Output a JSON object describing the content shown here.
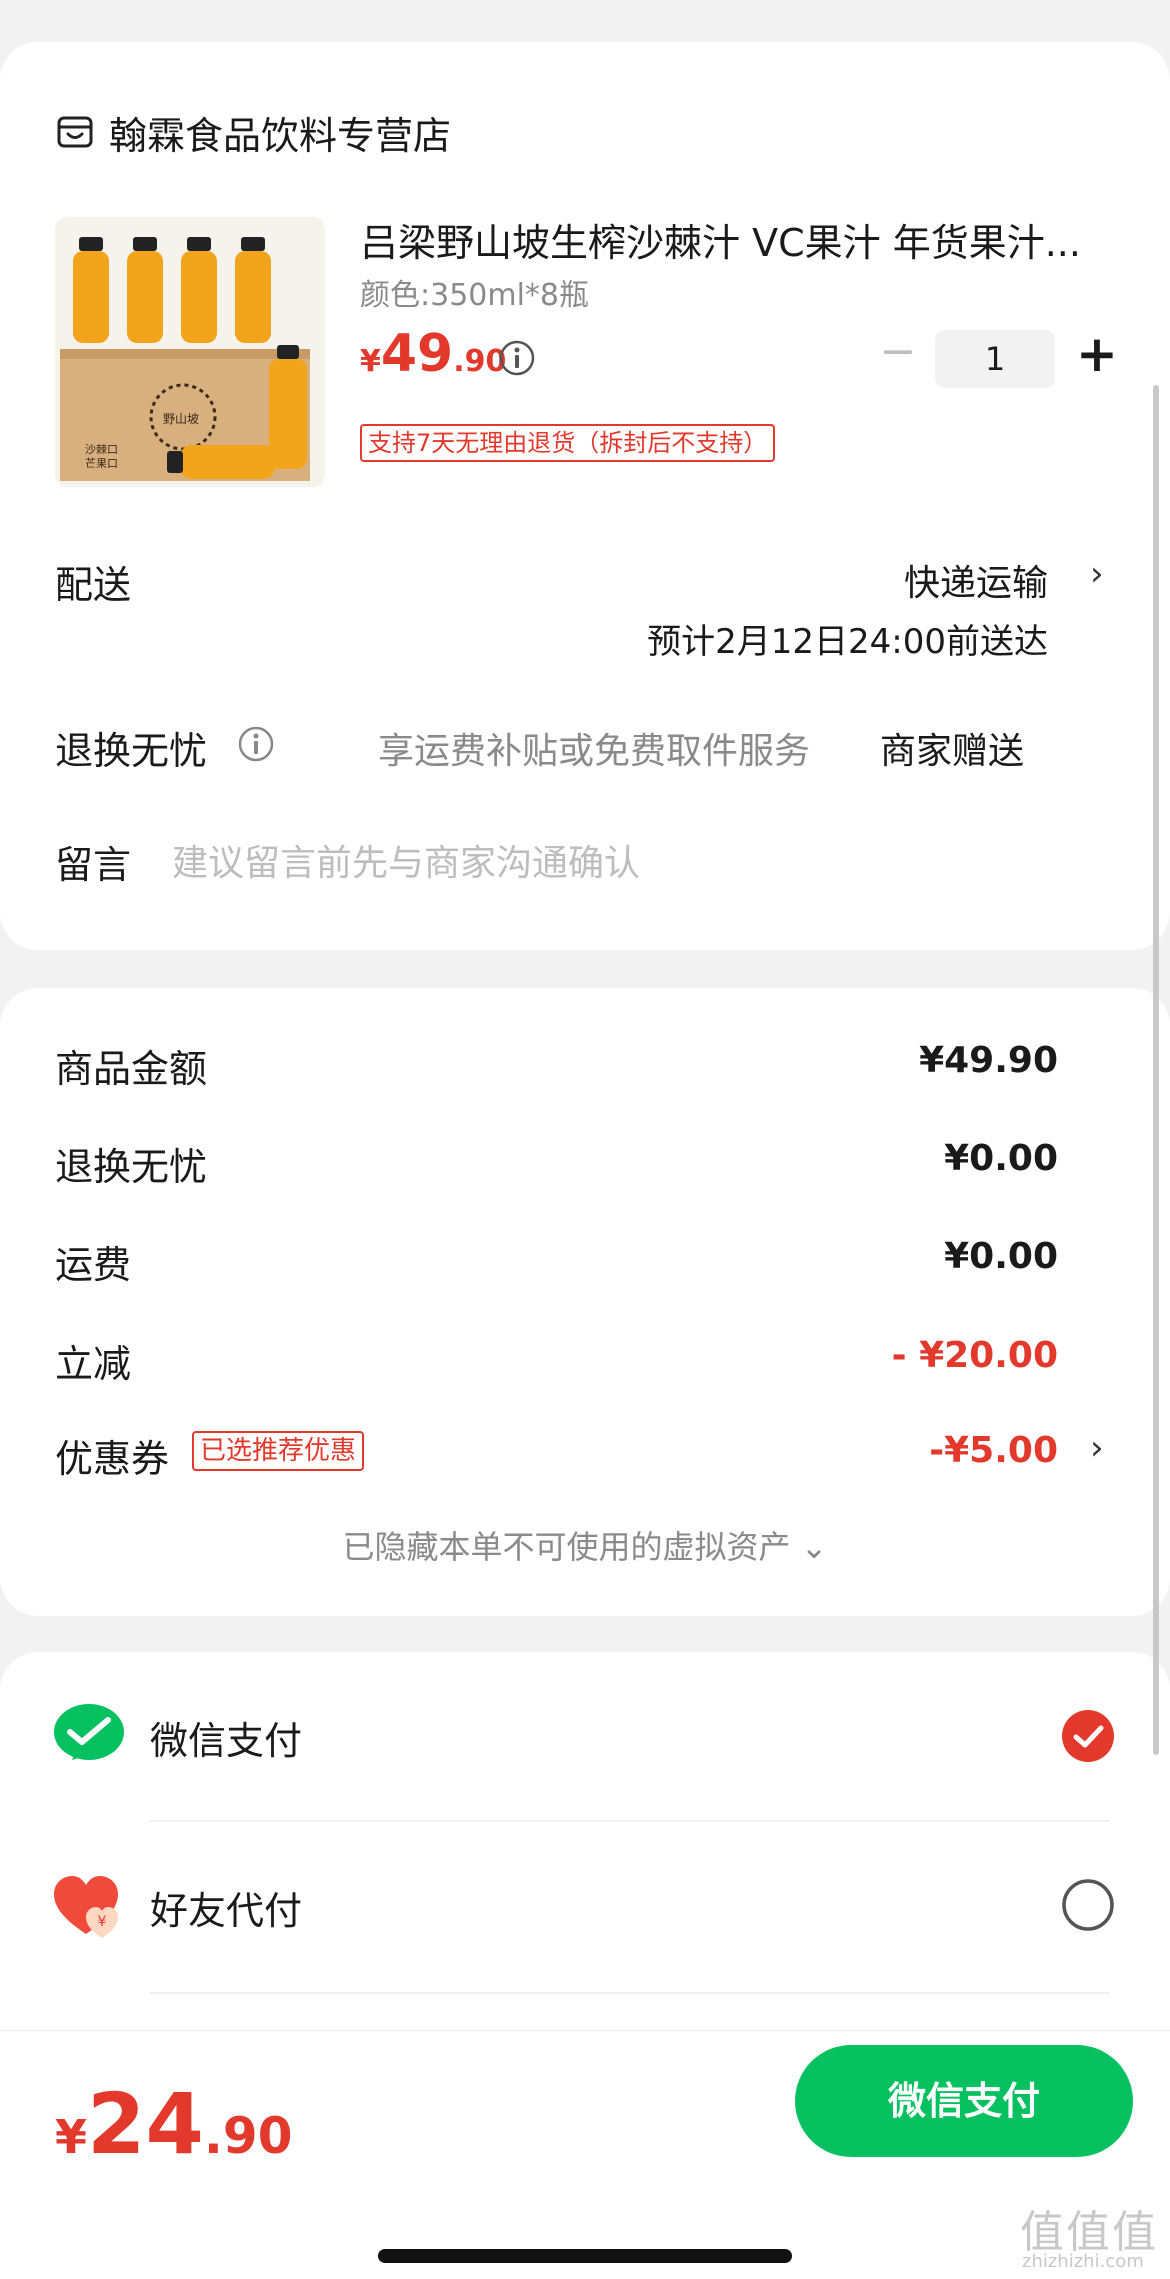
{
  "store": {
    "name": "翰霖食品饮料专营店",
    "icon": "store-icon"
  },
  "product": {
    "title": "吕梁野山坡生榨沙棘汁 VC果汁 年货果汁...",
    "spec": "颜色:350ml*8瓶",
    "price_symbol": "¥",
    "price_int": "49",
    "price_dec": ".90",
    "quantity": "1",
    "minus": "−",
    "plus": "+",
    "return_tag": "支持7天无理由退货（拆封后不支持）",
    "image_text_box": "野山坡",
    "image_text_side": "沙棘口\n芒果口"
  },
  "delivery": {
    "label": "配送",
    "method": "快递运输",
    "eta": "预计2月12日24:00前送达"
  },
  "worry_free": {
    "label": "退换无忧",
    "desc": "享运费补贴或免费取件服务",
    "value": "商家赠送"
  },
  "note": {
    "label": "留言",
    "placeholder": "建议留言前先与商家沟通确认"
  },
  "summary": {
    "rows": [
      {
        "label": "商品金额",
        "value": "¥49.90"
      },
      {
        "label": "退换无忧",
        "value": "¥0.00"
      },
      {
        "label": "运费",
        "value": "¥0.00"
      },
      {
        "label": "立减",
        "value": "- ¥20.00"
      }
    ],
    "coupon": {
      "label": "优惠券",
      "tag": "已选推荐优惠",
      "value": "-¥5.00"
    },
    "hidden_assets": "已隐藏本单不可使用的虚拟资产 ⌄"
  },
  "payment": {
    "options": [
      {
        "label": "微信支付",
        "selected": true
      },
      {
        "label": "好友代付",
        "selected": false
      }
    ]
  },
  "footer": {
    "total_symbol": "¥",
    "total_int": "24",
    "total_dec": ".90",
    "pay_button": "微信支付"
  },
  "watermark": {
    "glyphs": "值值值",
    "url": "zhizhizhi.com"
  },
  "colors": {
    "accent_red": "#e3392c",
    "wechat_green": "#07c160",
    "bg": "#f2f2f2"
  }
}
